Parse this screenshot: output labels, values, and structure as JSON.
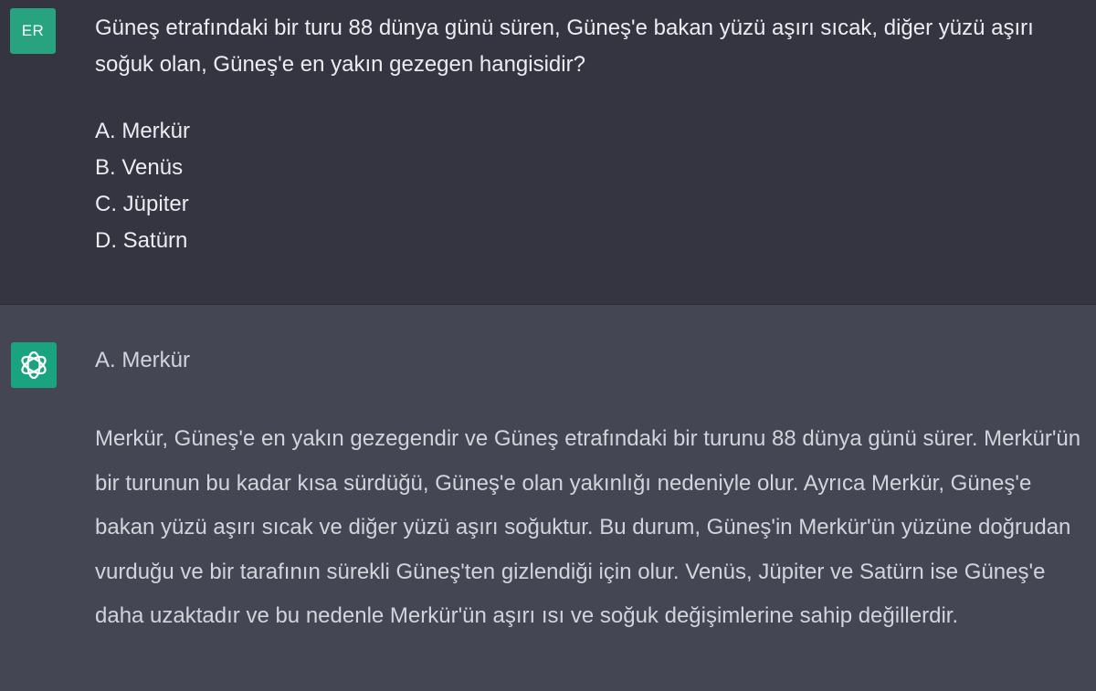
{
  "user_message": {
    "avatar_initials": "ER",
    "question": "Güneş etrafındaki bir turu 88 dünya günü süren, Güneş'e bakan yüzü aşırı sıcak, diğer yüzü aşırı soğuk olan, Güneş'e en yakın gezegen hangisidir?",
    "options": [
      "A. Merkür",
      "B. Venüs",
      "C. Jüpiter",
      "D. Satürn"
    ]
  },
  "assistant_message": {
    "avatar_icon": "openai-logo-icon",
    "answer": "A. Merkür",
    "explanation": "Merkür, Güneş'e en yakın gezegendir ve Güneş etrafındaki bir turunu 88 dünya günü sürer. Merkür'ün bir turunun bu kadar kısa sürdüğü, Güneş'e olan yakınlığı nedeniyle olur. Ayrıca Merkür, Güneş'e bakan yüzü aşırı sıcak ve diğer yüzü aşırı soğuktur. Bu durum, Güneş'in Merkür'ün yüzüne doğrudan vurduğu ve bir tarafının sürekli Güneş'ten gizlendiği için olur. Venüs, Jüpiter ve Satürn ise Güneş'e daha uzaktadır ve bu nedenle Merkür'ün aşırı ısı ve soğuk değişimlerine sahip değillerdir."
  },
  "colors": {
    "user_background": "#343541",
    "assistant_background": "#444654",
    "user_avatar": "#27a37f",
    "assistant_avatar": "#19a37f",
    "user_text": "#ececf1",
    "assistant_text": "#d1d5db"
  }
}
